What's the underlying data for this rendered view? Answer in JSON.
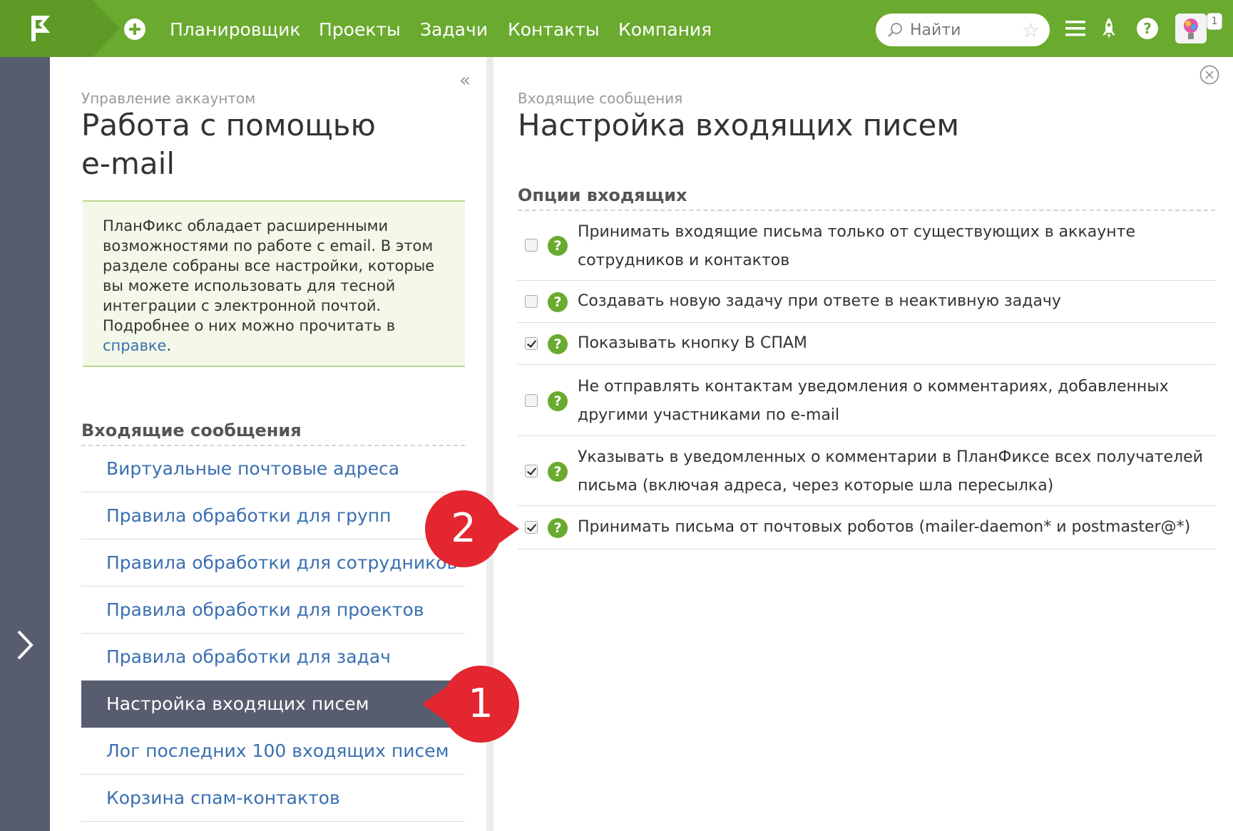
{
  "topbar": {
    "nav": [
      "Планировщик",
      "Проекты",
      "Задачи",
      "Контакты",
      "Компания"
    ],
    "search_placeholder": "Найти",
    "notification_count": "1",
    "colors": {
      "bar": "#6aaa2f",
      "logo_bg": "#5d9b26"
    },
    "icons": [
      "logo-flag-icon",
      "add-icon",
      "search-icon",
      "star-icon",
      "menu-icon",
      "rocket-icon",
      "help-icon",
      "avatar"
    ]
  },
  "left": {
    "breadcrumb": "Управление аккаунтом",
    "title_line1": "Работа с помощью",
    "title_line2": "e-mail",
    "info_text": "ПланФикс обладает расширенными возможностями по работе с email. В этом разделе собраны все настройки, которые вы можете использовать для тесной интеграции с электронной почтой. Подробнее о них можно прочитать в",
    "info_link": "справке",
    "info_end": ".",
    "section_title": "Входящие сообщения",
    "menu": [
      "Виртуальные почтовые адреса",
      "Правила обработки для групп",
      "Правила обработки для сотрудников",
      "Правила обработки для проектов",
      "Правила обработки для задач",
      "Настройка входящих писем",
      "Лог последних 100 входящих писем",
      "Корзина спам-контактов"
    ],
    "active_index": 5
  },
  "right": {
    "breadcrumb": "Входящие сообщения",
    "title": "Настройка входящих писем",
    "section_title": "Опции входящих",
    "options": [
      {
        "label": "Принимать входящие письма только от существующих в аккаунте сотрудников и контактов",
        "checked": false
      },
      {
        "label": "Создавать новую задачу при ответе в неактивную задачу",
        "checked": false
      },
      {
        "label": "Показывать кнопку В СПАМ",
        "checked": true
      },
      {
        "label": "Не отправлять контактам уведомления о комментариях, добавленных другими участниками по e-mail",
        "checked": false
      },
      {
        "label": "Указывать в уведомленных о комментарии в ПланФиксе всех получателей письма (включая адреса, через которые шла пересылка)",
        "checked": true
      },
      {
        "label": "Принимать письма от почтовых роботов (mailer-daemon* и postmaster@*)",
        "checked": true
      }
    ]
  },
  "callouts": {
    "first": "1",
    "second": "2",
    "color": "#e3262f"
  }
}
